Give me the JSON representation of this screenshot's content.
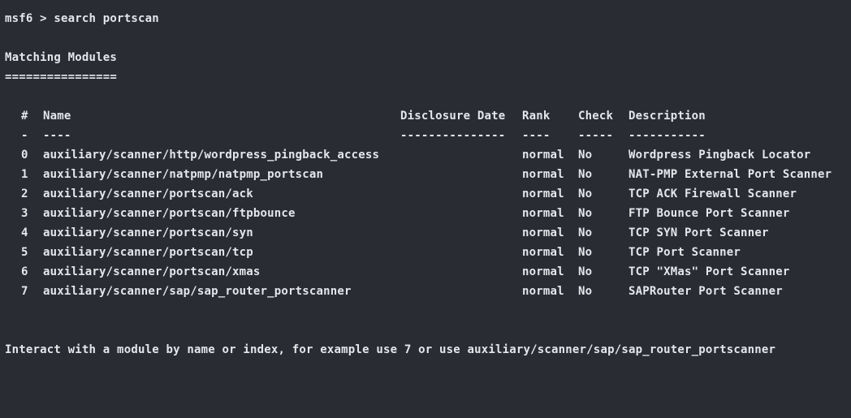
{
  "prompt": {
    "text": "msf6 > search portscan"
  },
  "section": {
    "title": "Matching Modules",
    "underline": "================"
  },
  "table": {
    "headers": {
      "index": "#",
      "name": "Name",
      "date": "Disclosure Date",
      "rank": "Rank",
      "check": "Check",
      "description": "Description"
    },
    "separators": {
      "index": "-",
      "name": "----",
      "date": "---------------",
      "rank": "----",
      "check": "-----",
      "description": "-----------"
    },
    "rows": [
      {
        "index": "0",
        "name": "auxiliary/scanner/http/wordpress_pingback_access",
        "date": "",
        "rank": "normal",
        "check": "No",
        "description": "Wordpress Pingback Locator"
      },
      {
        "index": "1",
        "name": "auxiliary/scanner/natpmp/natpmp_portscan",
        "date": "",
        "rank": "normal",
        "check": "No",
        "description": "NAT-PMP External Port Scanner"
      },
      {
        "index": "2",
        "name": "auxiliary/scanner/portscan/ack",
        "date": "",
        "rank": "normal",
        "check": "No",
        "description": "TCP ACK Firewall Scanner"
      },
      {
        "index": "3",
        "name": "auxiliary/scanner/portscan/ftpbounce",
        "date": "",
        "rank": "normal",
        "check": "No",
        "description": "FTP Bounce Port Scanner"
      },
      {
        "index": "4",
        "name": "auxiliary/scanner/portscan/syn",
        "date": "",
        "rank": "normal",
        "check": "No",
        "description": "TCP SYN Port Scanner"
      },
      {
        "index": "5",
        "name": "auxiliary/scanner/portscan/tcp",
        "date": "",
        "rank": "normal",
        "check": "No",
        "description": "TCP Port Scanner"
      },
      {
        "index": "6",
        "name": "auxiliary/scanner/portscan/xmas",
        "date": "",
        "rank": "normal",
        "check": "No",
        "description": "TCP \"XMas\" Port Scanner"
      },
      {
        "index": "7",
        "name": "auxiliary/scanner/sap/sap_router_portscanner",
        "date": "",
        "rank": "normal",
        "check": "No",
        "description": "SAPRouter Port Scanner"
      }
    ]
  },
  "footer": {
    "text": "Interact with a module by name or index, for example use 7 or use auxiliary/scanner/sap/sap_router_portscanner"
  },
  "colors": {
    "background": "#2a2c34",
    "foreground": "#e4e6ea"
  }
}
